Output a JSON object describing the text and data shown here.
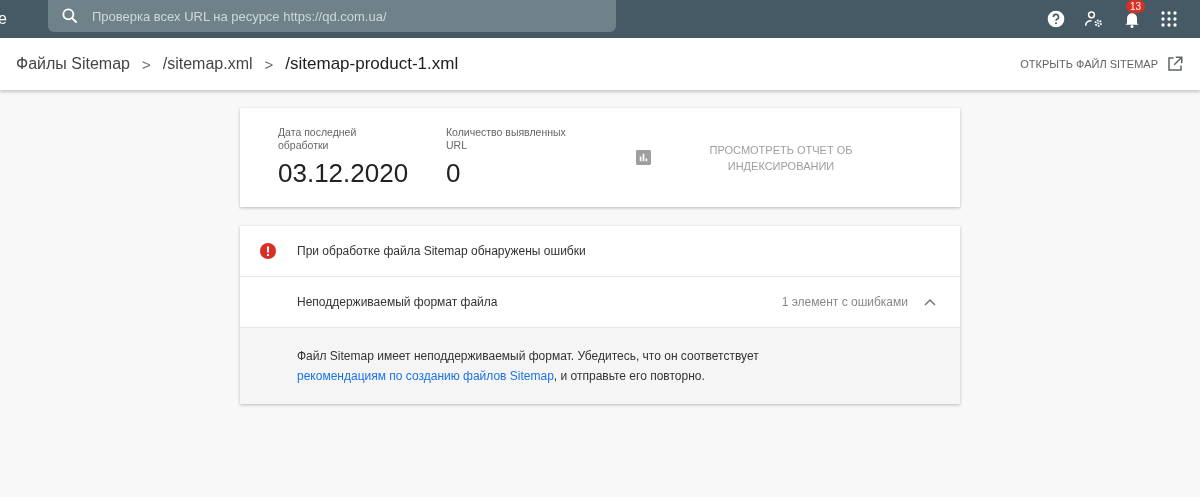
{
  "top_bar": {
    "cut_text": "e",
    "search": {
      "placeholder": "Проверка всех URL на ресурсе https://qd.com.ua/"
    },
    "notifications": {
      "count": "13"
    }
  },
  "breadcrumbs": [
    {
      "label": "Файлы Sitemap",
      "current": false
    },
    {
      "label": "/sitemap.xml",
      "current": false
    },
    {
      "label": "/sitemap-product-1.xml",
      "current": true
    }
  ],
  "separator": ">",
  "open_button": "ОТКРЫТЬ ФАЙЛ SITEMAP",
  "stats": [
    {
      "label": "Дата последней обработки",
      "value": "03.12.2020"
    },
    {
      "label": "Количество выявленных URL",
      "value": "0"
    }
  ],
  "report_button": "ПРОСМОТРЕТЬ ОТЧЕТ ОБ ИНДЕКСИРОВАНИИ",
  "errors": {
    "title": "При обработке файла Sitemap обнаружены ошибки",
    "items": [
      {
        "name": "Неподдерживаемый формат файла",
        "count": "1 элемент с ошибками",
        "expanded": true,
        "detail": {
          "before": "Файл Sitemap имеет неподдерживаемый формат. Убедитесь, что он соответствует",
          "link": "рекомендациям по созданию файлов Sitemap",
          "after": ", и отправьте его повторно."
        }
      }
    ]
  }
}
